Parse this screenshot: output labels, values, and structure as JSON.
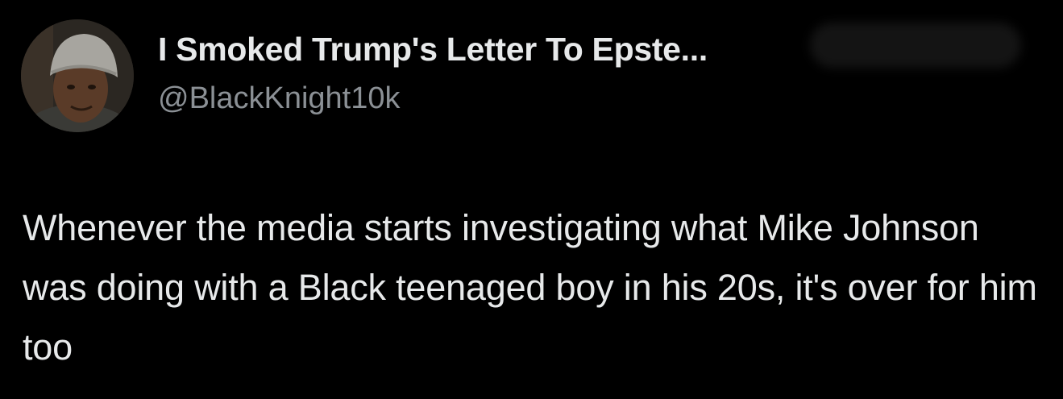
{
  "author": {
    "display_name": "I Smoked Trump's Letter To Epste...",
    "handle": "@BlackKnight10k",
    "avatar_icon": "profile-photo-icon"
  },
  "tweet": {
    "text": "Whenever the media starts investigating what Mike Johnson was doing with a Black teenaged boy in his 20s, it's over for him too"
  },
  "colors": {
    "background": "#000000",
    "primary_text": "#e7e9ea",
    "secondary_text": "#8b9095"
  }
}
